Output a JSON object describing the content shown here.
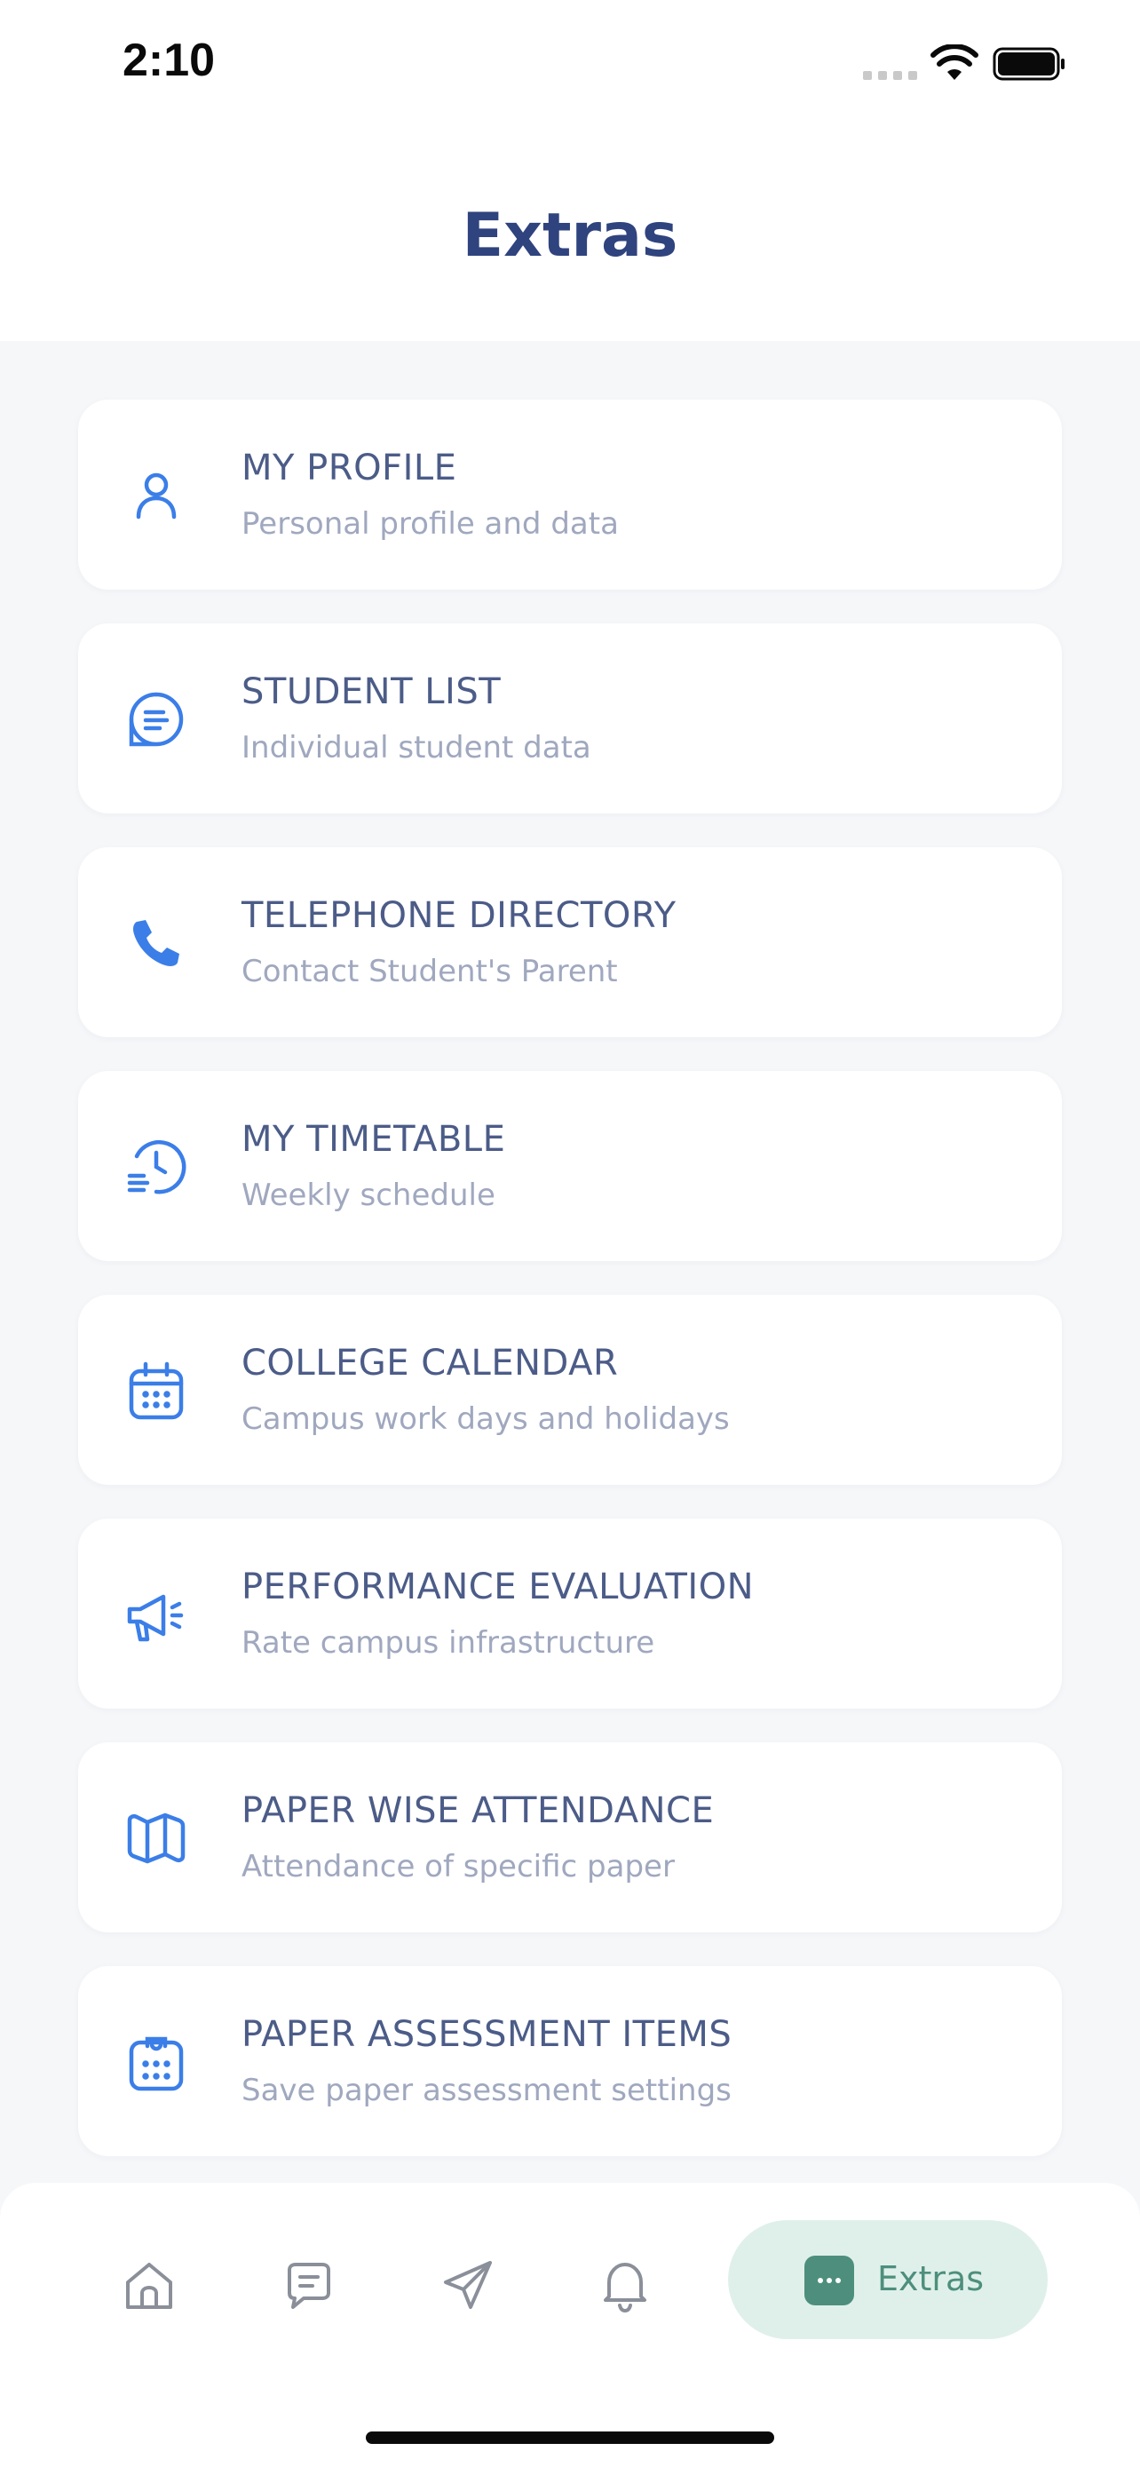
{
  "status_bar": {
    "time": "2:10"
  },
  "header": {
    "title": "Extras"
  },
  "menu": [
    {
      "title": "MY PROFILE",
      "subtitle": "Personal profile and data",
      "icon": "user-icon"
    },
    {
      "title": "STUDENT LIST",
      "subtitle": "Individual student data",
      "icon": "list-bubble-icon"
    },
    {
      "title": "TELEPHONE DIRECTORY",
      "subtitle": "Contact Student's Parent",
      "icon": "phone-icon"
    },
    {
      "title": "MY TIMETABLE",
      "subtitle": "Weekly schedule",
      "icon": "clock-list-icon"
    },
    {
      "title": "COLLEGE CALENDAR",
      "subtitle": "Campus work days and holidays",
      "icon": "calendar-icon"
    },
    {
      "title": "PERFORMANCE EVALUATION",
      "subtitle": "Rate campus infrastructure",
      "icon": "megaphone-icon"
    },
    {
      "title": "PAPER WISE ATTENDANCE",
      "subtitle": "Attendance of specific paper",
      "icon": "map-icon"
    },
    {
      "title": "PAPER ASSESSMENT ITEMS",
      "subtitle": "Save paper assessment settings",
      "icon": "clipboard-icon"
    }
  ],
  "tab_bar": {
    "items": [
      "home-icon",
      "chat-icon",
      "send-icon",
      "bell-icon"
    ],
    "active_label": "Extras",
    "active_icon": "more-dots-icon"
  },
  "colors": {
    "accent_blue": "#3b7ee8",
    "title_navy": "#2f437e",
    "active_green": "#4d8f7c",
    "active_bg": "#dff0ea"
  }
}
